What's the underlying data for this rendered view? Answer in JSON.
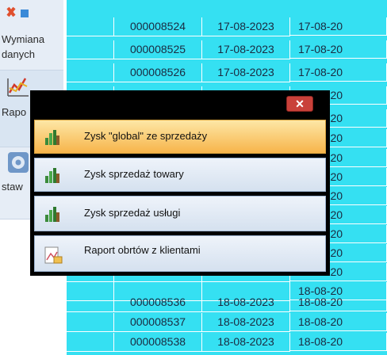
{
  "sidebar": {
    "items": [
      {
        "label": "Wymiana\ndanych",
        "icon": "data-exchange-icon"
      },
      {
        "label": "Rapo",
        "icon": "chart-icon"
      },
      {
        "label": "staw",
        "icon": "settings-gear-icon"
      }
    ]
  },
  "table": {
    "rows": [
      {
        "num": "000008524",
        "date": "17-08-2023",
        "date2": "17-08-20"
      },
      {
        "num": "000008525",
        "date": "17-08-2023",
        "date2": "17-08-20"
      },
      {
        "num": "000008526",
        "date": "17-08-2023",
        "date2": "17-08-20"
      },
      {
        "num": "",
        "date": "",
        "date2": "17-08-20"
      },
      {
        "num": "",
        "date": "",
        "date2": "17-08-20"
      },
      {
        "num": "",
        "date": "",
        "date2": "17-08-20"
      },
      {
        "num": "",
        "date": "",
        "date2": "17-08-20"
      },
      {
        "num": "",
        "date": "",
        "date2": "17-08-20"
      },
      {
        "num": "",
        "date": "",
        "date2": "18-08-20"
      },
      {
        "num": "",
        "date": "",
        "date2": "18-08-20"
      },
      {
        "num": "",
        "date": "",
        "date2": "18-08-20"
      },
      {
        "num": "",
        "date": "",
        "date2": "18-08-20"
      },
      {
        "num": "",
        "date": "",
        "date2": "18-08-20"
      },
      {
        "num": "",
        "date": "",
        "date2": "18-08-20"
      },
      {
        "num": "000008536",
        "date": "18-08-2023",
        "date2": "18-08-20"
      },
      {
        "num": "000008537",
        "date": "18-08-2023",
        "date2": "18-08-20"
      },
      {
        "num": "000008538",
        "date": "18-08-2023",
        "date2": "18-08-20"
      }
    ]
  },
  "popup": {
    "close_label": "✕",
    "items": [
      {
        "label": "Zysk \"global\" ze sprzedaży",
        "active": true,
        "icon": "profit-chart-icon"
      },
      {
        "label": "Zysk sprzedaż towary",
        "active": false,
        "icon": "profit-chart-icon"
      },
      {
        "label": "Zysk sprzedaż usługi",
        "active": false,
        "icon": "profit-chart-icon"
      },
      {
        "label": "Raport obrtów z klientami",
        "active": false,
        "icon": "client-report-icon"
      }
    ]
  },
  "colors": {
    "grid_bg": "#35e0f2",
    "active_item": "#f7b44a",
    "close_button": "#c9413a"
  }
}
